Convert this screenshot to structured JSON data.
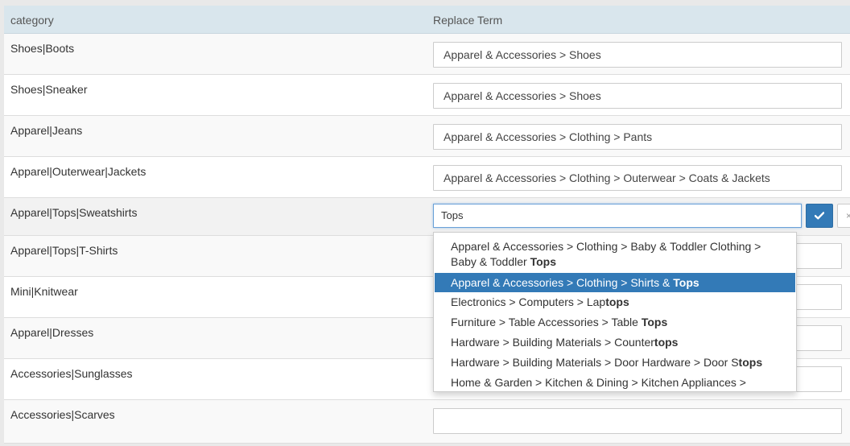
{
  "table": {
    "headers": {
      "category": "category",
      "replace_term": "Replace Term"
    },
    "rows": [
      {
        "category": "Shoes|Boots",
        "term": "Apparel & Accessories > Shoes"
      },
      {
        "category": "Shoes|Sneaker",
        "term": "Apparel & Accessories > Shoes"
      },
      {
        "category": "Apparel|Jeans",
        "term": "Apparel & Accessories > Clothing > Pants"
      },
      {
        "category": "Apparel|Outerwear|Jackets",
        "term": "Apparel & Accessories > Clothing > Outerwear > Coats & Jackets"
      },
      {
        "category": "Apparel|Tops|Sweatshirts",
        "term": "Tops"
      },
      {
        "category": "Apparel|Tops|T-Shirts",
        "term": ""
      },
      {
        "category": "Mini|Knitwear",
        "term": ""
      },
      {
        "category": "Apparel|Dresses",
        "term": ""
      },
      {
        "category": "Accessories|Sunglasses",
        "term": ""
      },
      {
        "category": "Accessories|Scarves",
        "term": ""
      }
    ]
  },
  "editor": {
    "confirm_icon": "check-icon",
    "cancel_icon": "close-icon",
    "cancel_glyph": "×"
  },
  "colors": {
    "header_bg": "#d9e6ed",
    "accent": "#337ab7",
    "focus_border": "#6aa1d8"
  },
  "autocomplete": {
    "selected_index": 1,
    "suggestions": [
      {
        "line1": "Apparel & Accessories > Clothing > Baby & Toddler Clothing >",
        "line2_plain": "Baby & Toddler ",
        "line2_bold": "Tops"
      },
      {
        "plain": "Apparel & Accessories > Clothing > Shirts & ",
        "bold": "Tops"
      },
      {
        "plain": "Electronics > Computers > Lap",
        "bold": "tops"
      },
      {
        "plain": "Furniture > Table Accessories > Table ",
        "bold": "Tops"
      },
      {
        "plain": "Hardware > Building Materials > Counter",
        "bold": "tops"
      },
      {
        "plain": "Hardware > Building Materials > Door Hardware > Door S",
        "bold": "tops"
      },
      {
        "plain": "Home & Garden > Kitchen & Dining > Kitchen Appliances >",
        "bold": ""
      }
    ]
  }
}
